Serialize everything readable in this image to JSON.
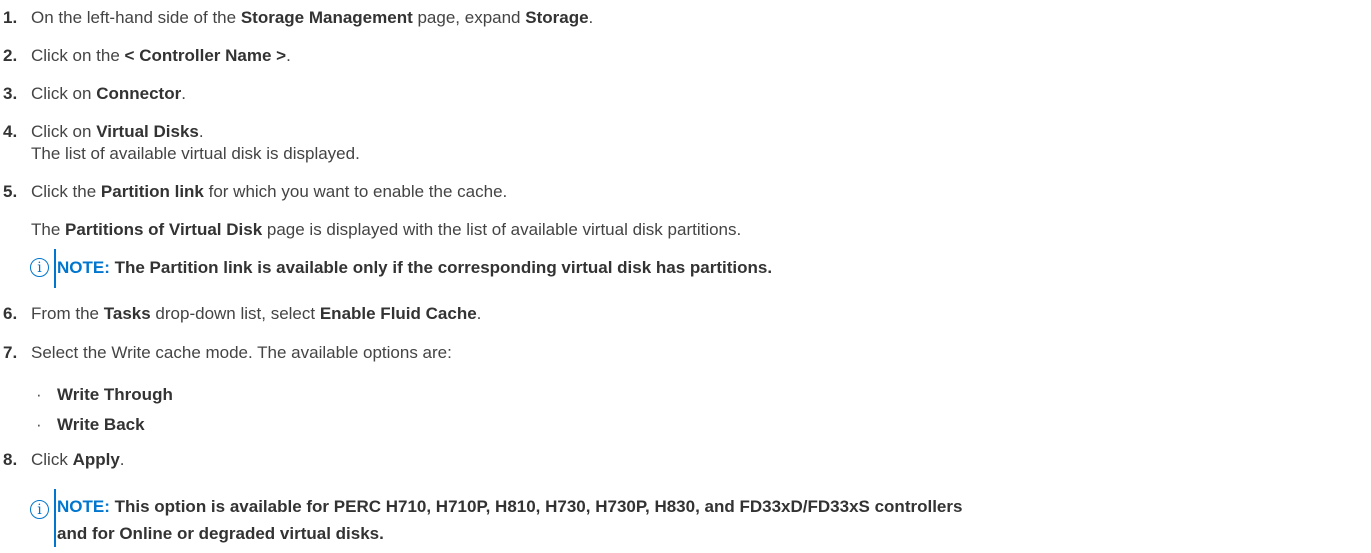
{
  "steps": [
    {
      "num": "1.",
      "pre": "On the left-hand side of the ",
      "b1": "Storage Management",
      "mid": " page, expand ",
      "b2": "Storage",
      "post": "."
    },
    {
      "num": "2.",
      "pre": "Click on the ",
      "b1": "< Controller Name >",
      "post": "."
    },
    {
      "num": "3.",
      "pre": "Click on ",
      "b1": "Connector",
      "post": "."
    },
    {
      "num": "4.",
      "pre": "Click on ",
      "b1": "Virtual Disks",
      "post": ".",
      "sub": "The list of available virtual disk is displayed."
    },
    {
      "num": "5.",
      "pre": "Click the ",
      "b1": "Partition link",
      "post": " for which you want to enable the cache."
    },
    {
      "num": "6.",
      "pre": "From the ",
      "b1": "Tasks",
      "mid": " drop-down list, select ",
      "b2": "Enable Fluid Cache",
      "post": "."
    },
    {
      "num": "7.",
      "pre": "Select the Write cache mode. The available options are:"
    },
    {
      "num": "8.",
      "pre": "Click ",
      "b1": "Apply",
      "post": "."
    }
  ],
  "step5_detail": {
    "pre": "The ",
    "b1": "Partitions of Virtual Disk",
    "post": " page is displayed with the list of available virtual disk partitions."
  },
  "note1": {
    "label": "NOTE:",
    "text": " The Partition link is available only if the corresponding virtual disk has partitions."
  },
  "options": [
    "Write Through",
    "Write Back"
  ],
  "note2": {
    "label": "NOTE:",
    "line1": " This option is available for PERC H710, H710P, H810, H730, H730P, H830, and FD33xD/FD33xS controllers",
    "line2": "and for Online or degraded virtual disks."
  },
  "colors": {
    "accent": "#0076ce",
    "text": "#444444"
  }
}
